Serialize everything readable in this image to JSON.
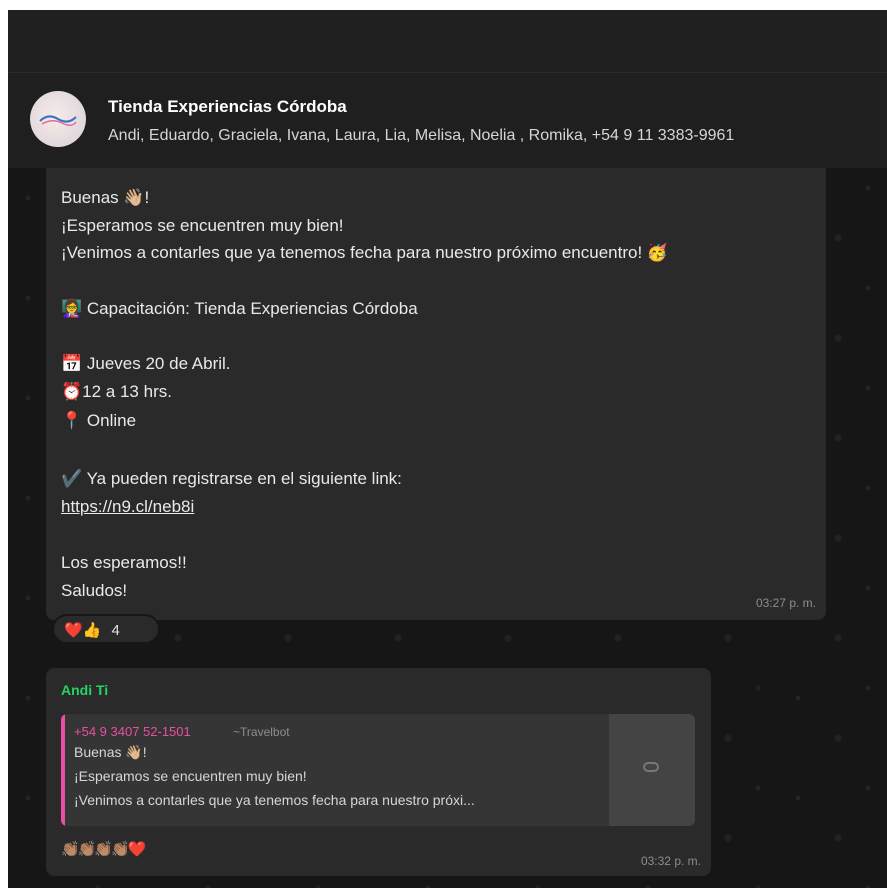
{
  "header": {
    "title": "Tienda Experiencias Córdoba",
    "members": "Andi, Eduardo, Graciela, Ivana, Laura, Lia, Melisa, Noelia , Romika, +54 9 11 3383-9961"
  },
  "message1": {
    "lines": {
      "l1": "Buenas 👋🏼!",
      "l2": "¡Esperamos se encuentren muy bien!",
      "l3": "¡Venimos a contarles que ya tenemos fecha para nuestro próximo encuentro! 🥳",
      "l4": "👩‍🏫 Capacitación: Tienda Experiencias Córdoba",
      "l5": "📅 Jueves 20 de Abril.",
      "l6": "⏰12 a 13 hrs.",
      "l7": "📍 Online",
      "l8": "✔️ Ya pueden registrarse en el siguiente link:",
      "link": "https://n9.cl/neb8i",
      "l9": "Los esperamos!!",
      "l10": "Saludos!"
    },
    "time": "03:27 p. m.",
    "reactions": {
      "emojis": "❤️👍",
      "count": "4"
    }
  },
  "message2": {
    "sender": "Andi Ti",
    "quote": {
      "phone": "+54 9 3407 52-1501",
      "name": "~Travelbot",
      "line1": "Buenas 👋🏼!",
      "line2": "¡Esperamos se encuentren muy bien!",
      "line3": "¡Venimos a contarles que ya tenemos fecha para nuestro próxi..."
    },
    "text": "👏🏽👏🏽👏🏽👏🏽❤️",
    "time": "03:32 p. m."
  },
  "colors": {
    "accent_green": "#25d366",
    "link_blue": "#53bdeb",
    "quote_pink": "#e94fa4",
    "bubble_bg": "#2a2a2a"
  }
}
